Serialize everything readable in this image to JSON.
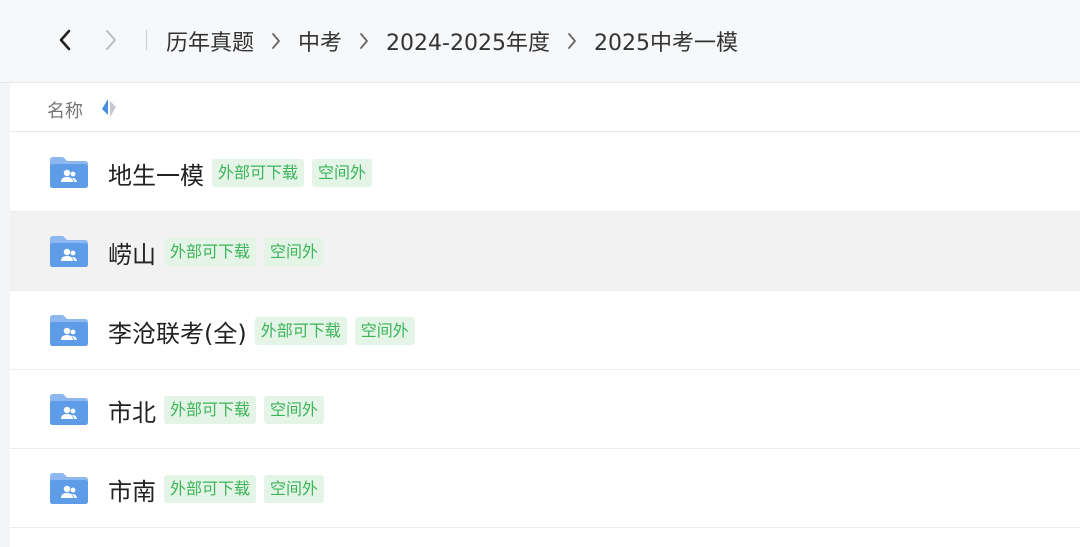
{
  "colors": {
    "accent": "#4a90e2",
    "tag_bg": "#e4f5e7",
    "tag_text": "#3db45a",
    "hover_row": "#f2f2f3"
  },
  "nav": {
    "back_icon": "chevron-left-icon",
    "forward_icon": "chevron-right-icon"
  },
  "breadcrumb": [
    {
      "label": "历年真题"
    },
    {
      "label": "中考"
    },
    {
      "label": "2024-2025年度"
    },
    {
      "label": "2025中考一模"
    }
  ],
  "list_header": {
    "name_label": "名称",
    "sort_icon": "sort-icon"
  },
  "folders": [
    {
      "name": "地生一模",
      "tags": [
        "外部可下载",
        "空间外"
      ],
      "icon": "shared-folder-icon"
    },
    {
      "name": "崂山",
      "tags": [
        "外部可下载",
        "空间外"
      ],
      "icon": "shared-folder-icon"
    },
    {
      "name": "李沧联考(全)",
      "tags": [
        "外部可下载",
        "空间外"
      ],
      "icon": "shared-folder-icon"
    },
    {
      "name": "市北",
      "tags": [
        "外部可下载",
        "空间外"
      ],
      "icon": "shared-folder-icon"
    },
    {
      "name": "市南",
      "tags": [
        "外部可下载",
        "空间外"
      ],
      "icon": "shared-folder-icon"
    }
  ]
}
